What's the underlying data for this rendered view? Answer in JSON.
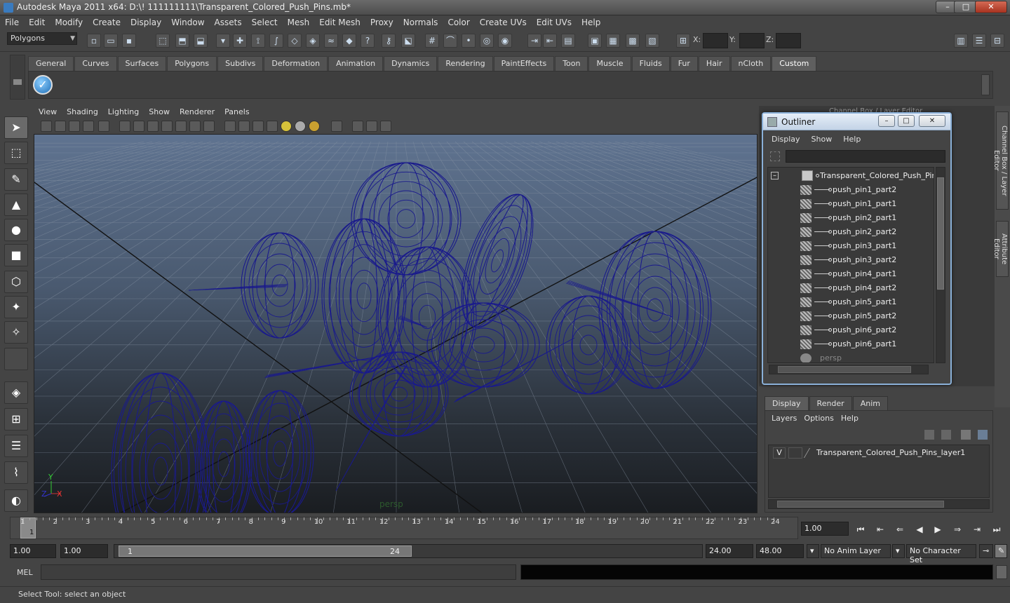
{
  "window": {
    "title": "Autodesk Maya 2011 x64: D:\\! 111111111\\Transparent_Colored_Push_Pins.mb*",
    "controls": [
      "–",
      "□",
      "✕"
    ]
  },
  "menubar": [
    "File",
    "Edit",
    "Modify",
    "Create",
    "Display",
    "Window",
    "Assets",
    "Select",
    "Mesh",
    "Edit Mesh",
    "Proxy",
    "Normals",
    "Color",
    "Create UVs",
    "Edit UVs",
    "Help"
  ],
  "statusline": {
    "mode": "Polygons",
    "x_label": "X:",
    "y_label": "Y:",
    "z_label": "Z:"
  },
  "shelf": {
    "tabs": [
      "General",
      "Curves",
      "Surfaces",
      "Polygons",
      "Subdivs",
      "Deformation",
      "Animation",
      "Dynamics",
      "Rendering",
      "PaintEffects",
      "Toon",
      "Muscle",
      "Fluids",
      "Fur",
      "Hair",
      "nCloth",
      "Custom"
    ],
    "active_tab": "Custom"
  },
  "viewport": {
    "menu": [
      "View",
      "Shading",
      "Lighting",
      "Show",
      "Renderer",
      "Panels"
    ],
    "camera_label": "persp",
    "axis": {
      "x": "X",
      "y": "Y",
      "z": "Z"
    },
    "wire_color": "#1a1a8c"
  },
  "channel_box": {
    "title": "Channel Box / Layer Editor"
  },
  "side_tabs": [
    "Channel Box / Layer Editor",
    "Attribute Editor"
  ],
  "outliner": {
    "title": "Outliner",
    "menu": [
      "Display",
      "Show",
      "Help"
    ],
    "root": "Transparent_Colored_Push_Pins",
    "children": [
      "push_pin1_part2",
      "push_pin1_part1",
      "push_pin2_part1",
      "push_pin2_part2",
      "push_pin3_part1",
      "push_pin3_part2",
      "push_pin4_part1",
      "push_pin4_part2",
      "push_pin5_part1",
      "push_pin5_part2",
      "push_pin6_part2",
      "push_pin6_part1"
    ],
    "camera": "persp"
  },
  "layer_editor": {
    "tabs": [
      "Display",
      "Render",
      "Anim"
    ],
    "active_tab": "Display",
    "menu": [
      "Layers",
      "Options",
      "Help"
    ],
    "layer": {
      "visible": "V",
      "name": "Transparent_Colored_Push_Pins_layer1"
    }
  },
  "timeline": {
    "ticks": [
      "1",
      "2",
      "3",
      "4",
      "5",
      "6",
      "7",
      "8",
      "9",
      "10",
      "11",
      "12",
      "13",
      "14",
      "15",
      "16",
      "17",
      "18",
      "19",
      "20",
      "21",
      "22",
      "23",
      "24"
    ],
    "current_marker": "1",
    "current_frame": "1.00"
  },
  "range": {
    "start": "1.00",
    "playback_start": "1.00",
    "handle_lo": "1",
    "handle_hi": "24",
    "playback_end": "24.00",
    "end": "48.00",
    "anim_layer": "No Anim Layer",
    "character_set": "No Character Set"
  },
  "command_line": {
    "label": "MEL"
  },
  "help_line": "Select Tool: select an object"
}
